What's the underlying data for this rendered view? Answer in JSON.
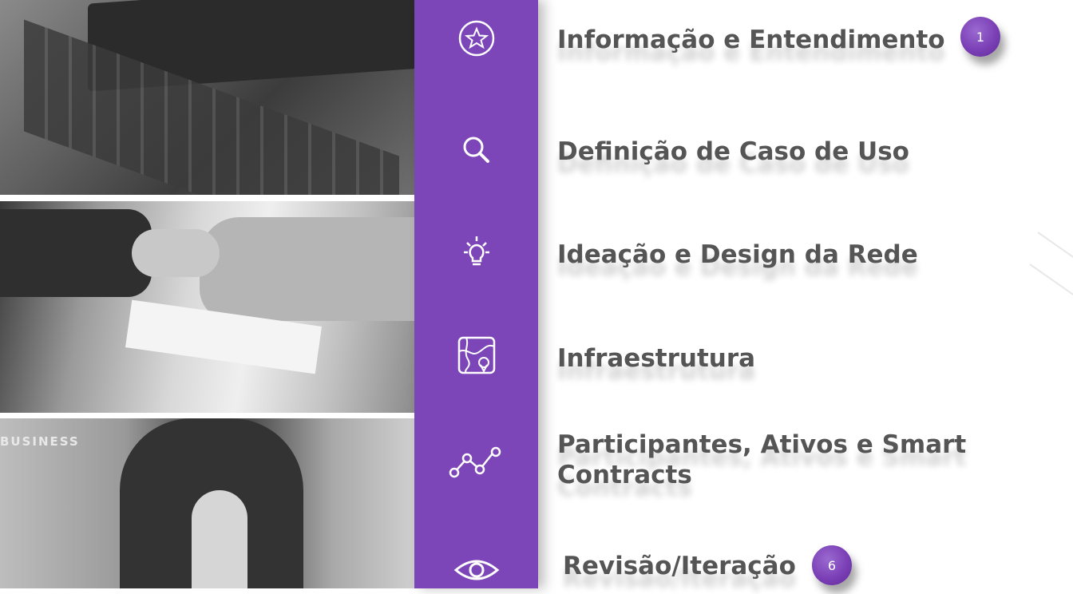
{
  "steps": [
    {
      "icon": "star-circle-icon",
      "label": "Informação e Entendimento"
    },
    {
      "icon": "magnifier-icon",
      "label": "Definição de Caso de Uso"
    },
    {
      "icon": "lightbulb-icon",
      "label": "Ideação e Design da Rede"
    },
    {
      "icon": "map-icon",
      "label": "Infraestrutura"
    },
    {
      "icon": "connected-nodes-icon",
      "label_line1": "Participantes, Ativos e Smart",
      "label_line2": "Contracts"
    },
    {
      "icon": "eye-icon",
      "label": "Revisão/Iteração"
    }
  ],
  "badges": {
    "first": "1",
    "last": "6"
  },
  "photos": {
    "business_text": "BUSINESS"
  },
  "colors": {
    "accent": "#7d46b8",
    "text": "#555555",
    "badge": "#7b3fb6"
  }
}
